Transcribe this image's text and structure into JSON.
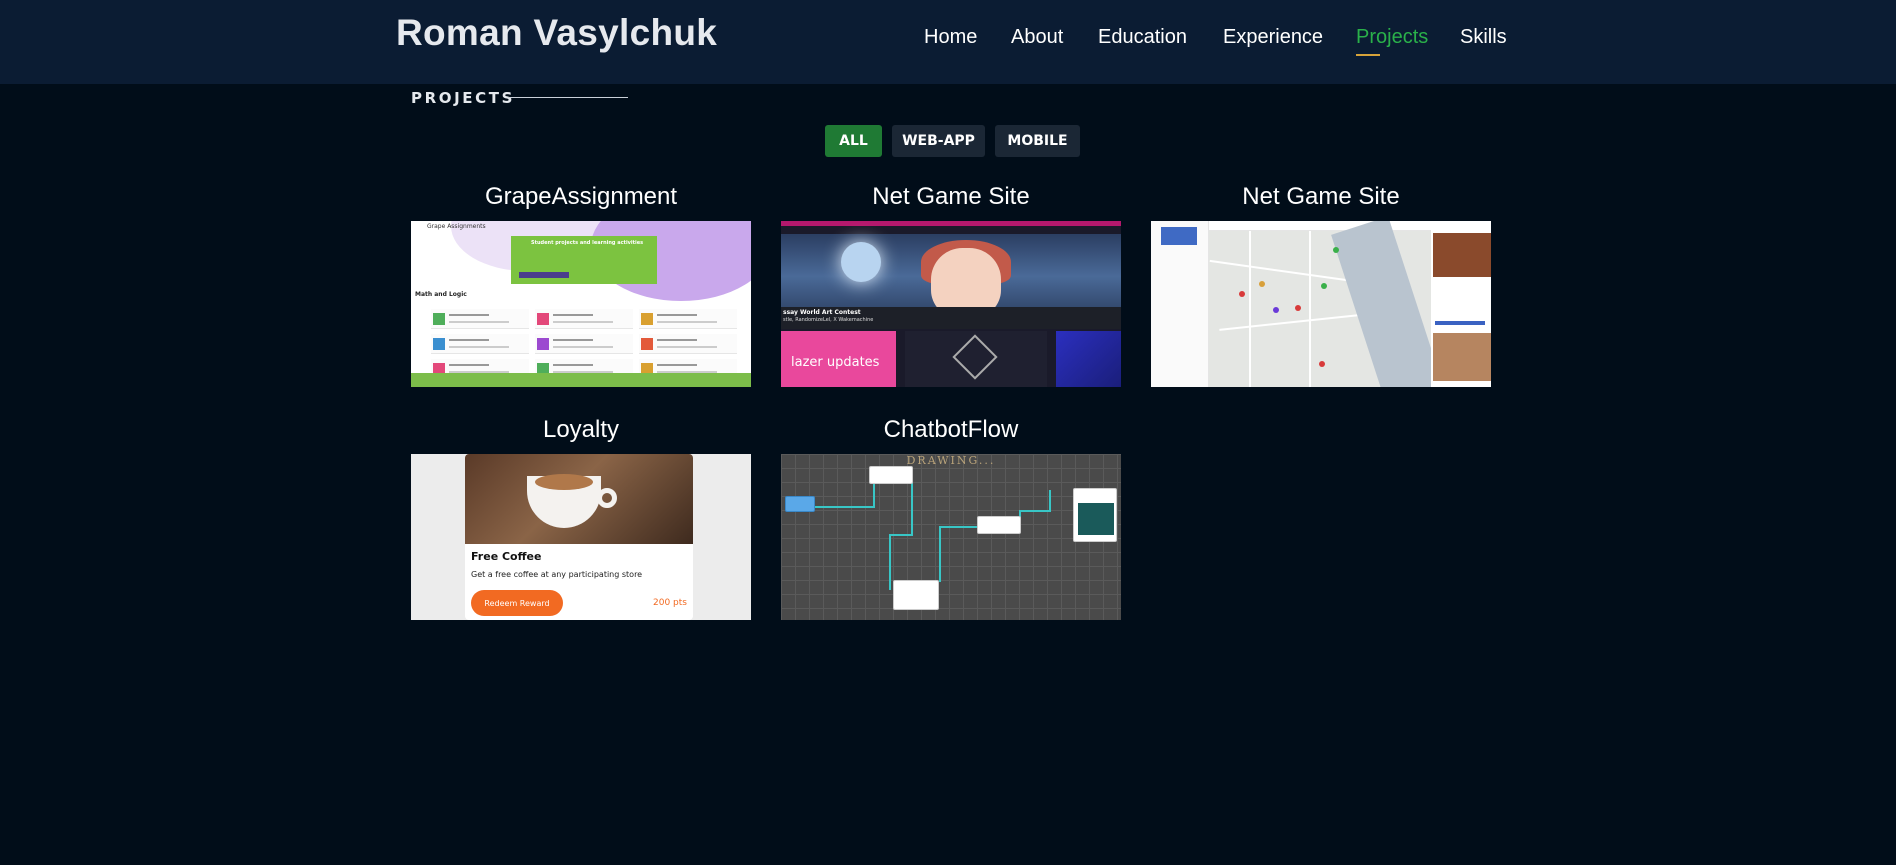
{
  "header": {
    "logo": "Roman Vasylchuk",
    "nav": [
      {
        "label": "Home",
        "active": false
      },
      {
        "label": "About",
        "active": false
      },
      {
        "label": "Education",
        "active": false
      },
      {
        "label": "Experience",
        "active": false
      },
      {
        "label": "Projects",
        "active": true
      },
      {
        "label": "Skills",
        "active": false
      }
    ]
  },
  "section": {
    "title": "PROJECTS"
  },
  "filters": [
    {
      "label": "ALL",
      "active": true
    },
    {
      "label": "WEB-APP",
      "active": false
    },
    {
      "label": "MOBILE",
      "active": false
    }
  ],
  "projects": [
    {
      "title": "GrapeAssignment"
    },
    {
      "title": "Net Game Site"
    },
    {
      "title": "Net Game Site"
    },
    {
      "title": "Loyalty"
    },
    {
      "title": "ChatbotFlow"
    }
  ],
  "thumbs": {
    "grape": {
      "app_name": "Grape Assignments",
      "banner": "Student projects and learning activities",
      "section": "Math and Logic"
    },
    "netgame": {
      "caption1": "ssay World Art Contest",
      "caption2": "stle, RandomizeLel, X Wakemachine",
      "tile": "lazer updates"
    },
    "loyalty": {
      "title": "Free Coffee",
      "desc": "Get a free coffee at any participating store",
      "button": "Redeem Reward",
      "points": "200 pts"
    },
    "chatbot": {
      "label": "DRAWING..."
    }
  },
  "colors": {
    "background": "#010d19",
    "header": "#0b1c33",
    "active_nav": "#2ab04a",
    "active_filter": "#1f7a34",
    "nav_underline": "#d7a33a"
  }
}
